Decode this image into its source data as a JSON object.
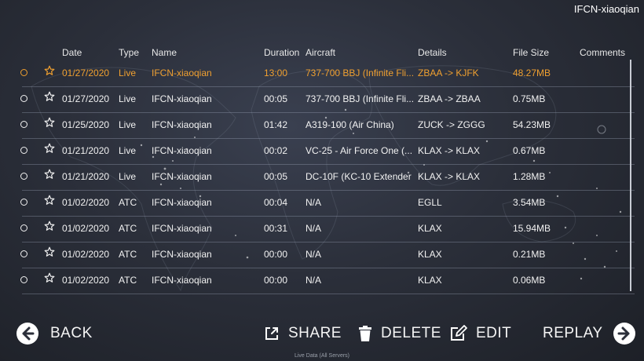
{
  "user": {
    "name": "IFCN-xiaoqian"
  },
  "columns": {
    "date": "Date",
    "type": "Type",
    "name": "Name",
    "duration": "Duration",
    "aircraft": "Aircraft",
    "details": "Details",
    "file_size": "File Size",
    "comments": "Comments"
  },
  "rows": [
    {
      "date": "01/27/2020",
      "type": "Live",
      "name": "IFCN-xiaoqian",
      "duration": "13:00",
      "aircraft": "737-700 BBJ (Infinite Fli...",
      "details": "ZBAA -> KJFK",
      "size": "48.27MB",
      "selected": true
    },
    {
      "date": "01/27/2020",
      "type": "Live",
      "name": "IFCN-xiaoqian",
      "duration": "00:05",
      "aircraft": "737-700 BBJ (Infinite Fli...",
      "details": "ZBAA -> ZBAA",
      "size": "0.75MB"
    },
    {
      "date": "01/25/2020",
      "type": "Live",
      "name": "IFCN-xiaoqian",
      "duration": "01:42",
      "aircraft": "A319-100 (Air China)",
      "details": "ZUCK -> ZGGG",
      "size": "54.23MB"
    },
    {
      "date": "01/21/2020",
      "type": "Live",
      "name": "IFCN-xiaoqian",
      "duration": "00:02",
      "aircraft": "VC-25 - Air Force One (...",
      "details": "KLAX -> KLAX",
      "size": "0.67MB"
    },
    {
      "date": "01/21/2020",
      "type": "Live",
      "name": "IFCN-xiaoqian",
      "duration": "00:05",
      "aircraft": "DC-10F (KC-10 Extender ...",
      "details": "KLAX -> KLAX",
      "size": "1.28MB"
    },
    {
      "date": "01/02/2020",
      "type": "ATC",
      "name": "IFCN-xiaoqian",
      "duration": "00:04",
      "aircraft": "N/A",
      "details": "EGLL",
      "size": "3.54MB"
    },
    {
      "date": "01/02/2020",
      "type": "ATC",
      "name": "IFCN-xiaoqian",
      "duration": "00:31",
      "aircraft": "N/A",
      "details": "KLAX",
      "size": "15.94MB"
    },
    {
      "date": "01/02/2020",
      "type": "ATC",
      "name": "IFCN-xiaoqian",
      "duration": "00:00",
      "aircraft": "N/A",
      "details": "KLAX",
      "size": "0.21MB"
    },
    {
      "date": "01/02/2020",
      "type": "ATC",
      "name": "IFCN-xiaoqian",
      "duration": "00:00",
      "aircraft": "N/A",
      "details": "KLAX",
      "size": "0.06MB"
    }
  ],
  "actions": {
    "back": "BACK",
    "share": "SHARE",
    "delete": "DELETE",
    "edit": "EDIT",
    "replay": "REPLAY"
  },
  "footer": "Live Data (All Servers)",
  "colors": {
    "selected": "#f0a030",
    "text": "#f2f2f2",
    "background": "#2b2f3a"
  },
  "icons": {
    "row_select": "radio-icon",
    "favorite": "star-icon",
    "back": "arrow-left-circle-icon",
    "share": "share-icon",
    "delete": "trash-icon",
    "edit": "edit-icon",
    "replay": "arrow-right-circle-icon"
  }
}
